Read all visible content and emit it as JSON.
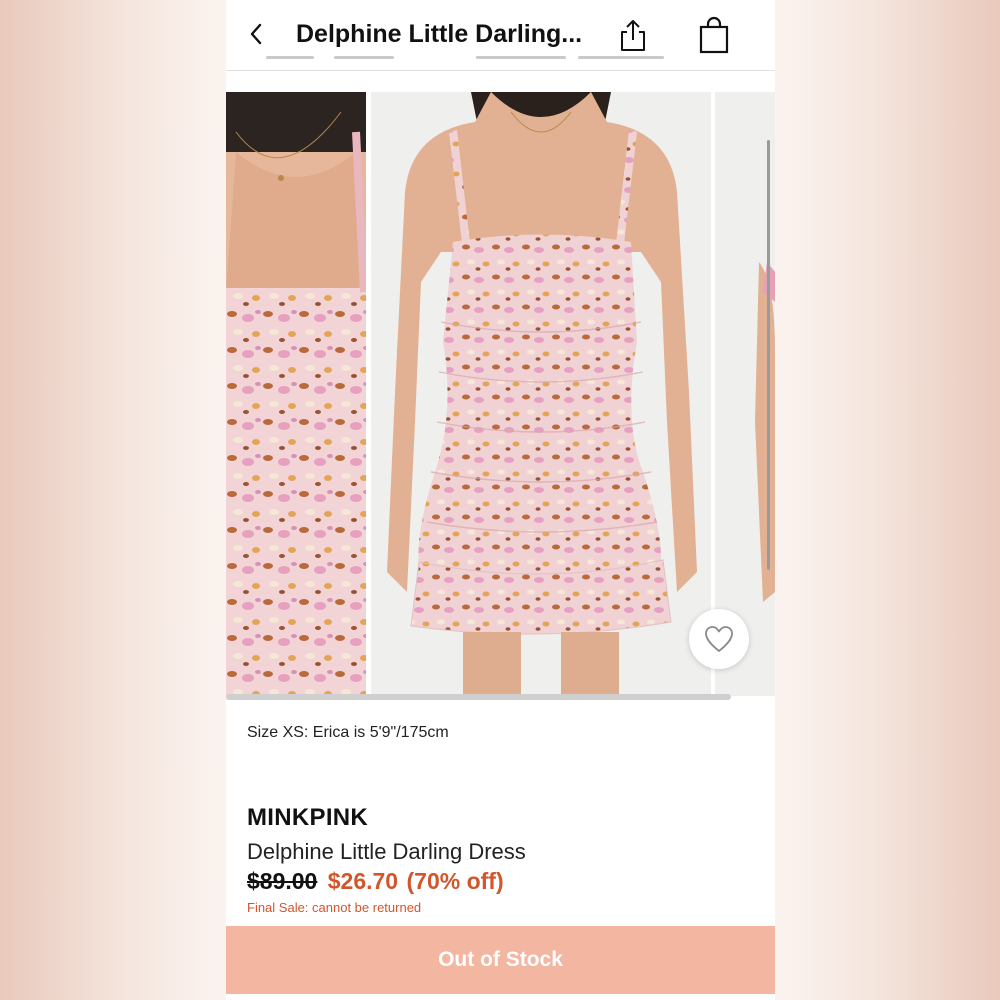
{
  "header": {
    "title": "Delphine Little Darling...",
    "back_icon": "chevron-left-icon",
    "share_icon": "share-icon",
    "bag_icon": "shopping-bag-icon"
  },
  "gallery": {
    "images": [
      "dress-detail-closeup",
      "dress-front-model",
      "dress-side-model"
    ],
    "favorite_icon": "heart-icon"
  },
  "size_note": "Size XS: Erica is 5'9\"/175cm",
  "product": {
    "brand": "MINKPINK",
    "name": "Delphine Little Darling Dress",
    "price_original": "$89.00",
    "price_sale": "$26.70",
    "discount": "(70% off)",
    "final_sale_note": "Final Sale: cannot be returned"
  },
  "cta": {
    "label": "Out of Stock"
  },
  "colors": {
    "sale": "#d2552b",
    "cta_background": "#f2b6a1",
    "cta_text": "#ffffff"
  }
}
